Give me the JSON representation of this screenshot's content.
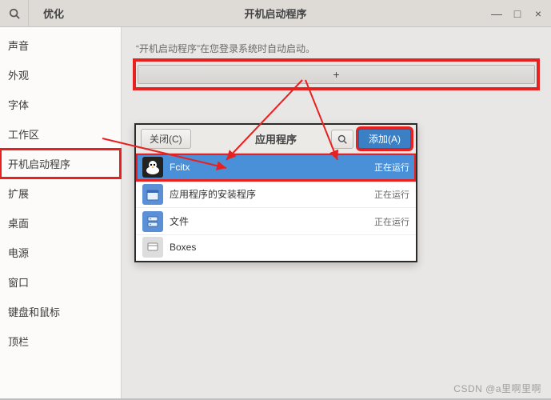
{
  "titlebar": {
    "app_name": "优化",
    "page_title": "开机启动程序"
  },
  "sidebar": {
    "items": [
      {
        "label": "声音"
      },
      {
        "label": "外观"
      },
      {
        "label": "字体"
      },
      {
        "label": "工作区"
      },
      {
        "label": "开机启动程序"
      },
      {
        "label": "扩展"
      },
      {
        "label": "桌面"
      },
      {
        "label": "电源"
      },
      {
        "label": "窗口"
      },
      {
        "label": "键盘和鼠标"
      },
      {
        "label": "顶栏"
      }
    ]
  },
  "main": {
    "desc": "“开机启动程序”在您登录系统时自动启动。",
    "add_button": "+"
  },
  "dialog": {
    "close": "关闭(C)",
    "title": "应用程序",
    "add": "添加(A)",
    "apps": [
      {
        "name": "Fcitx",
        "status": "正在运行",
        "selected": true
      },
      {
        "name": "应用程序的安装程序",
        "status": "正在运行"
      },
      {
        "name": "文件",
        "status": "正在运行"
      },
      {
        "name": "Boxes",
        "status": ""
      }
    ]
  },
  "watermark": "CSDN @a里啊里啊"
}
